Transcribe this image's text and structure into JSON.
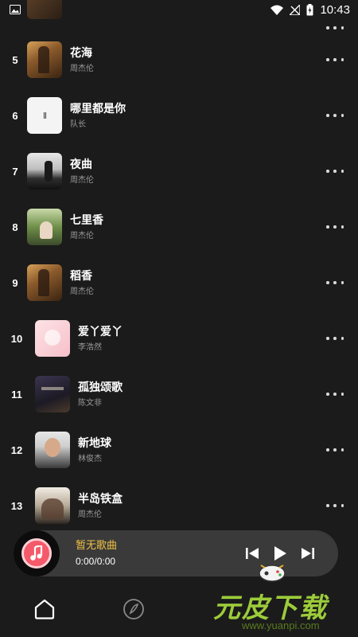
{
  "status_bar": {
    "time": "10:43",
    "icons": [
      "image-notification-icon",
      "wifi-icon",
      "no-signal-icon",
      "battery-charging-icon"
    ]
  },
  "songs": [
    {
      "index": "5",
      "title": "花海",
      "artist": "周杰伦",
      "cover": "warm"
    },
    {
      "index": "6",
      "title": "哪里都是你",
      "artist": "队长",
      "cover": "white"
    },
    {
      "index": "7",
      "title": "夜曲",
      "artist": "周杰伦",
      "cover": "night"
    },
    {
      "index": "8",
      "title": "七里香",
      "artist": "周杰伦",
      "cover": "field"
    },
    {
      "index": "9",
      "title": "稻香",
      "artist": "周杰伦",
      "cover": "warm"
    },
    {
      "index": "10",
      "title": "爱丫爱丫",
      "artist": "李浩然",
      "cover": "pink"
    },
    {
      "index": "11",
      "title": "孤独颂歌",
      "artist": "陈文非",
      "cover": "dark"
    },
    {
      "index": "12",
      "title": "新地球",
      "artist": "林俊杰",
      "cover": "face"
    },
    {
      "index": "13",
      "title": "半岛铁盒",
      "artist": "周杰伦",
      "cover": "island"
    }
  ],
  "player": {
    "title": "暂无歌曲",
    "time": "0:00/0:00",
    "accent": "#f0c244",
    "disc_color": "#f45a6a"
  },
  "nav": {
    "items": [
      "home-icon",
      "discover-icon"
    ]
  },
  "watermark": {
    "text": "元皮下载",
    "url": "www.yuanpi.com"
  }
}
